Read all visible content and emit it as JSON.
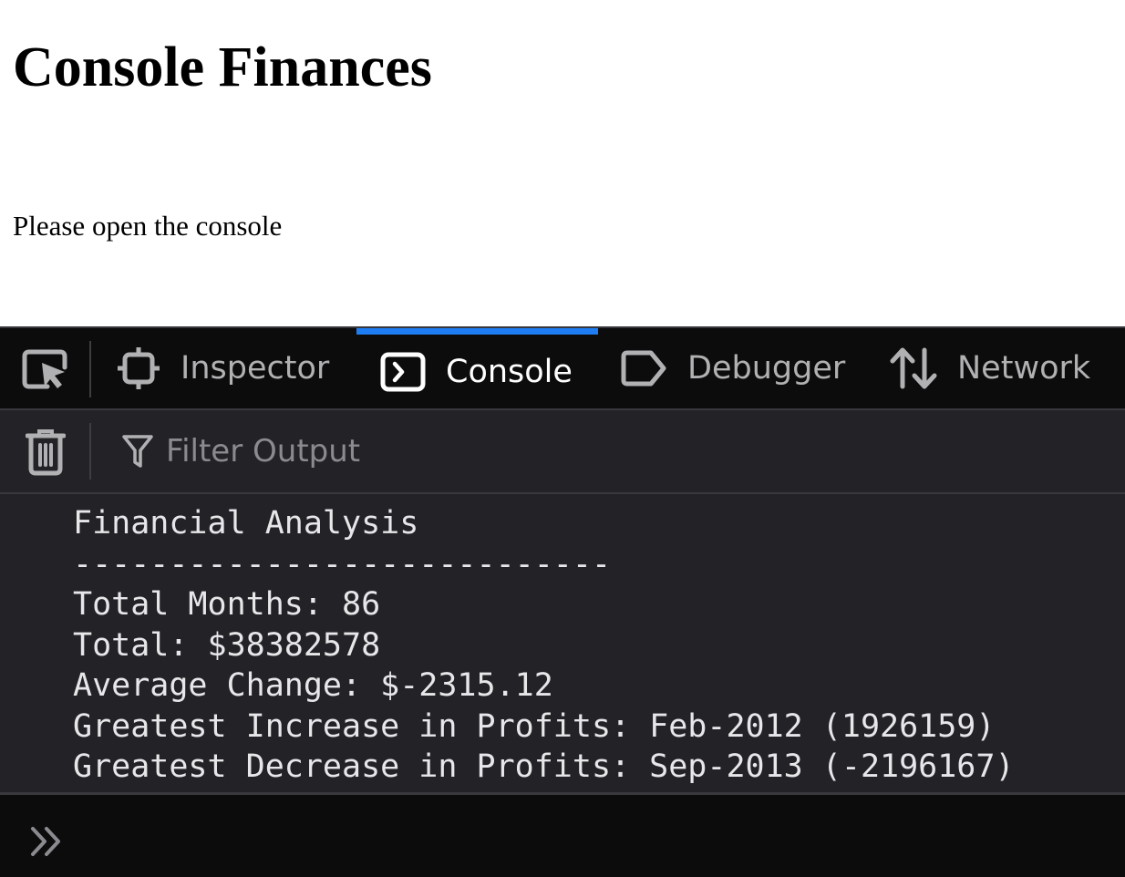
{
  "page": {
    "title": "Console Finances",
    "message": "Please open the console"
  },
  "devtools": {
    "tabs": [
      {
        "label": "Inspector",
        "icon": "inspector-icon",
        "selected": false
      },
      {
        "label": "Console",
        "icon": "console-icon",
        "selected": true
      },
      {
        "label": "Debugger",
        "icon": "debugger-icon",
        "selected": false
      },
      {
        "label": "Network",
        "icon": "network-icon",
        "selected": false
      }
    ],
    "toolbar": {
      "filter_placeholder": "Filter Output",
      "filter_value": ""
    },
    "console_output": [
      "Financial Analysis",
      "----------------------------",
      "Total Months: 86",
      "Total: $38382578",
      "Average Change: $-2315.12",
      "Greatest Increase in Profits: Feb-2012 (1926159)",
      "Greatest Decrease in Profits: Sep-2013 (-2196167)"
    ]
  },
  "colors": {
    "tab_selected_indicator": "#1e7df2",
    "devtools_background": "#0c0c0d",
    "console_background": "#232327",
    "console_text": "#e7e7e9",
    "tab_text": "#b1b1b3"
  }
}
